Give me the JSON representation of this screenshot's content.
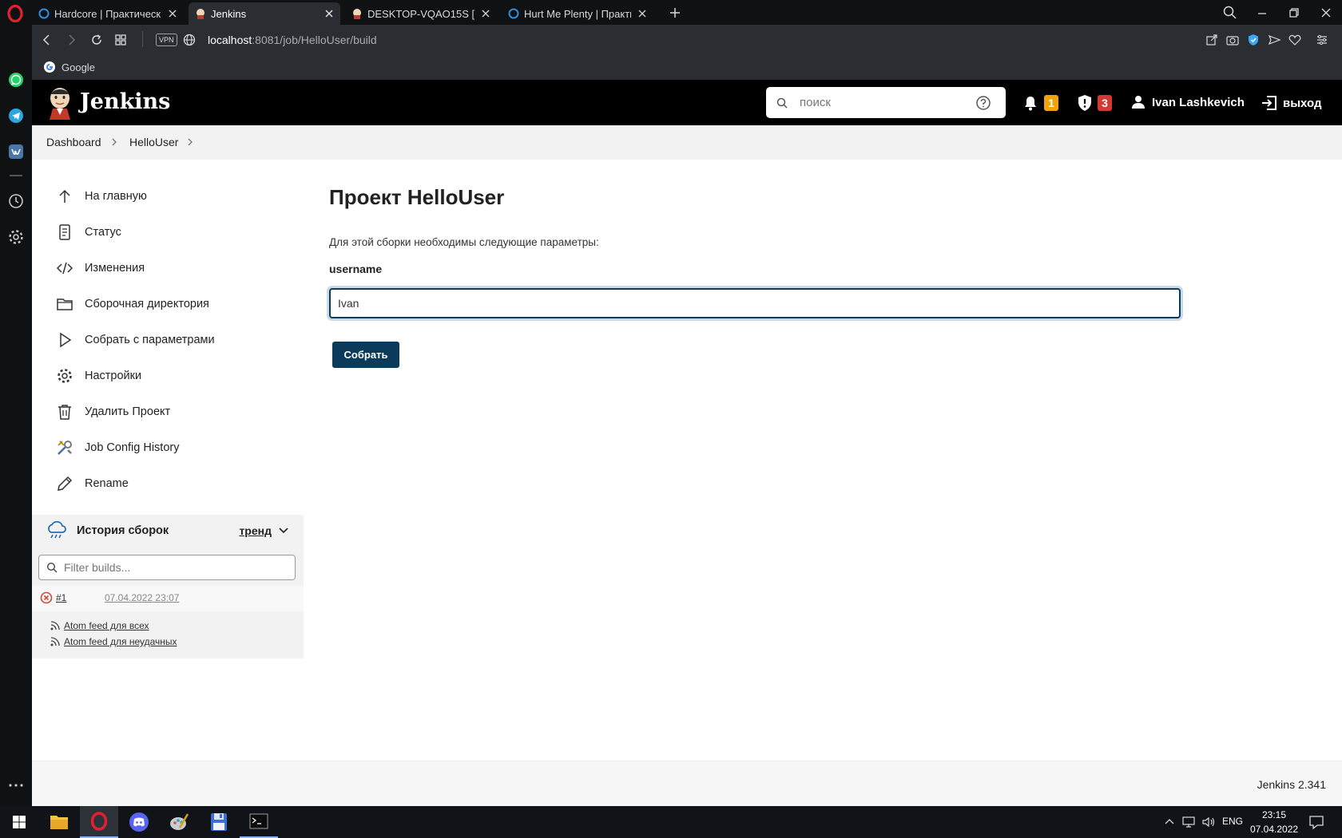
{
  "browser": {
    "tabs": [
      {
        "label": "Hardcore | Практические з",
        "active": false
      },
      {
        "label": "Jenkins",
        "active": true
      },
      {
        "label": "DESKTOP-VQAO15S [Jenkin",
        "active": false
      },
      {
        "label": "Hurt Me Plenty | Практиче",
        "active": false
      }
    ],
    "address": {
      "host": "localhost",
      "path": ":8081/job/HelloUser/build"
    },
    "vpn_label": "VPN",
    "bookmarks": [
      {
        "label": "Google"
      }
    ]
  },
  "jenkins": {
    "logo_text": "Jenkins",
    "search": {
      "placeholder": "поиск"
    },
    "notifications_count": "1",
    "security_count": "3",
    "user_name": "Ivan Lashkevich",
    "logout_label": "выход",
    "breadcrumbs": [
      "Dashboard",
      "HelloUser"
    ],
    "side_nav": [
      {
        "label": "На главную",
        "icon": "arrow-up-icon"
      },
      {
        "label": "Статус",
        "icon": "document-icon"
      },
      {
        "label": "Изменения",
        "icon": "code-icon"
      },
      {
        "label": "Сборочная директория",
        "icon": "folder-icon"
      },
      {
        "label": "Собрать с параметрами",
        "icon": "play-icon"
      },
      {
        "label": "Настройки",
        "icon": "gear-icon"
      },
      {
        "label": "Удалить Проект",
        "icon": "trash-icon"
      },
      {
        "label": "Job Config History",
        "icon": "tools-icon"
      },
      {
        "label": "Rename",
        "icon": "pencil-icon"
      }
    ],
    "build_history": {
      "title": "История сборок",
      "trend_label": "тренд",
      "filter_placeholder": "Filter builds...",
      "builds": [
        {
          "number": "#1",
          "date": "07.04.2022 23:07",
          "status": "failed"
        }
      ],
      "feeds": [
        {
          "label": "Atom feed для всех"
        },
        {
          "label": "Atom feed для неудачных"
        }
      ]
    },
    "main": {
      "title": "Проект HelloUser",
      "description": "Для этой сборки необходимы следующие параметры:",
      "param_name": "username",
      "param_value": "Ivan",
      "submit_label": "Собрать"
    },
    "version": "Jenkins 2.341"
  },
  "taskbar": {
    "lang": "ENG",
    "time": "23:15",
    "date": "07.04.2022"
  },
  "colors": {
    "jenkins_header": "#000000",
    "button_primary": "#0b3a5b",
    "input_focus": "#0b3a5b",
    "badge_warning": "#f0a30a",
    "badge_danger": "#d33833",
    "failed_status": "#d24939"
  }
}
